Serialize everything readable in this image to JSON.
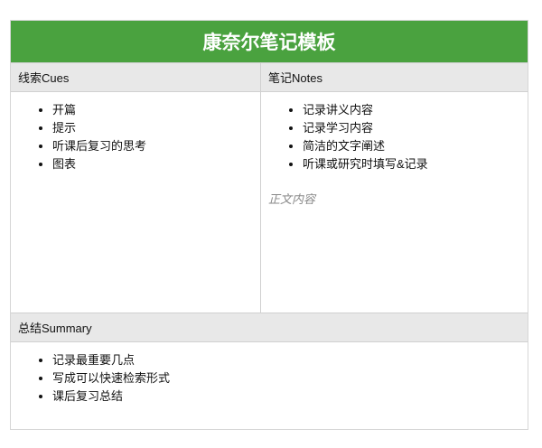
{
  "title": "康奈尔笔记模板",
  "cues": {
    "header": "线索Cues",
    "items": [
      "开篇",
      "提示",
      "听课后复习的思考",
      "图表"
    ]
  },
  "notes": {
    "header": "笔记Notes",
    "items": [
      "记录讲义内容",
      "记录学习内容",
      "简洁的文字阐述",
      "听课或研究时填写&记录"
    ],
    "placeholder": "正文内容"
  },
  "summary": {
    "header": "总结Summary",
    "items": [
      "记录最重要几点",
      "写成可以快速检索形式",
      "课后复习总结"
    ]
  },
  "colors": {
    "accent": "#4aa23f",
    "header_bg": "#e8e8e8"
  }
}
